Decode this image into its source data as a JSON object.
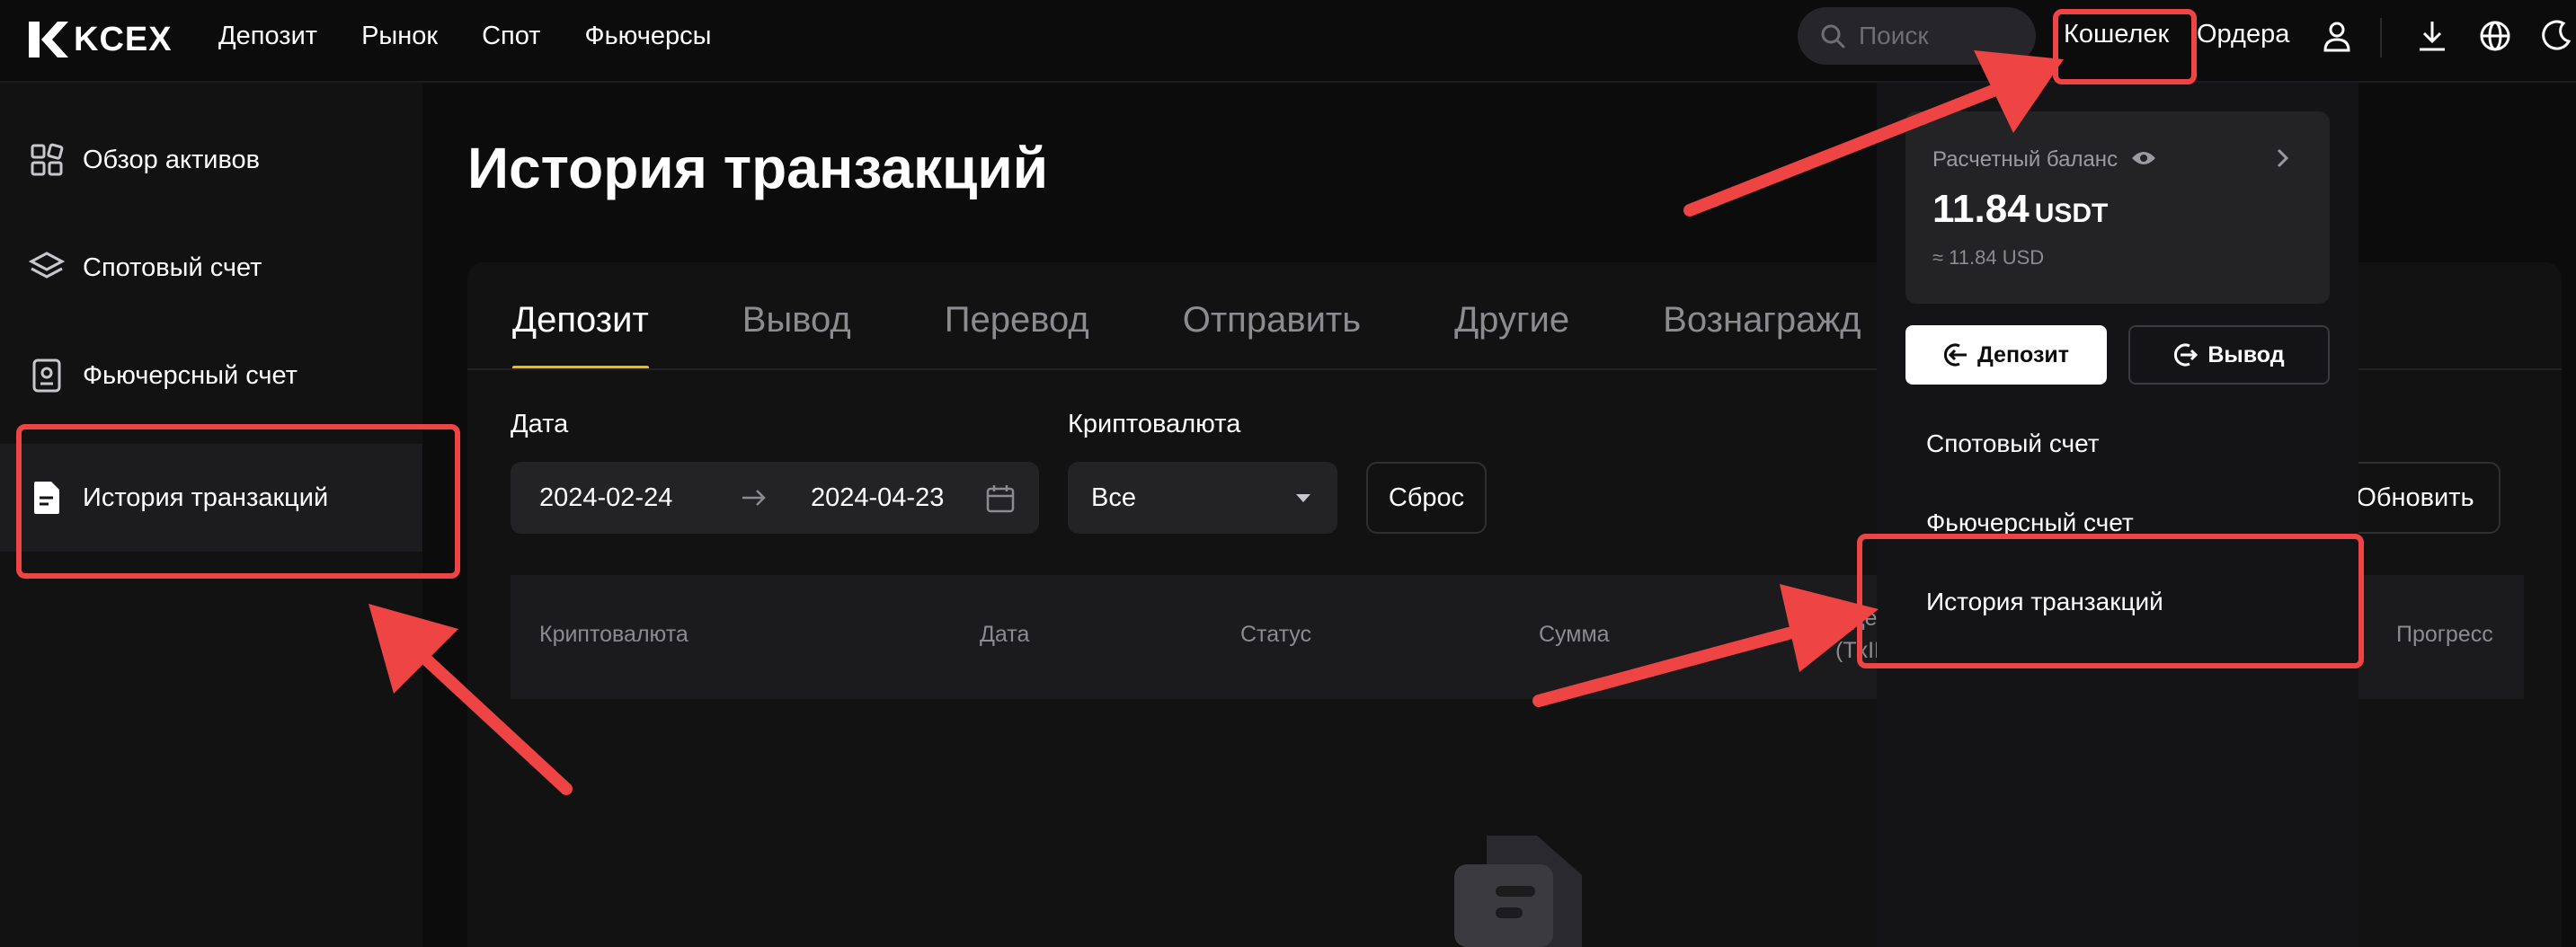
{
  "brand": {
    "name": "KCEX"
  },
  "nav": {
    "items": [
      "Депозит",
      "Рынок",
      "Спот",
      "Фьючерсы"
    ]
  },
  "header": {
    "search_placeholder": "Поиск",
    "wallet": "Кошелек",
    "orders": "Ордера",
    "icons": [
      "user-icon",
      "download-icon",
      "globe-icon",
      "moon-icon"
    ]
  },
  "sidebar": {
    "items": [
      {
        "label": "Обзор активов",
        "icon": "assets-grid-icon"
      },
      {
        "label": "Спотовый счет",
        "icon": "layers-icon"
      },
      {
        "label": "Фьючерсный счет",
        "icon": "futures-doc-icon"
      },
      {
        "label": "История транзакций",
        "icon": "history-doc-icon",
        "active": true
      }
    ]
  },
  "main": {
    "title": "История транзакций",
    "tabs": [
      "Депозит",
      "Вывод",
      "Перевод",
      "Отправить",
      "Другие",
      "Вознагражд"
    ],
    "active_tab": 0,
    "filters": {
      "date_label": "Дата",
      "date_from": "2024-02-24",
      "date_to": "2024-04-23",
      "crypto_label": "Криптовалюта",
      "crypto_value": "Все",
      "reset": "Сброс",
      "refresh": "Обновить"
    },
    "table": {
      "columns": [
        "Криптовалюта",
        "Дата",
        "Статус",
        "Сумма",
        "Иде",
        "(TxID",
        "Прогресс"
      ]
    }
  },
  "wallet_dropdown": {
    "balance_title": "Расчетный баланс",
    "balance_amount": "11.84",
    "balance_unit": "USDT",
    "balance_usd": "≈ 11.84 USD",
    "deposit_button": "Депозит",
    "withdraw_button": "Вывод",
    "items": [
      "Спотовый счет",
      "Фьючерсный счет",
      "История транзакций"
    ]
  },
  "colors": {
    "accent": "#f0b90b",
    "annotation": "#ef4444",
    "background": "#0c0c0d"
  }
}
